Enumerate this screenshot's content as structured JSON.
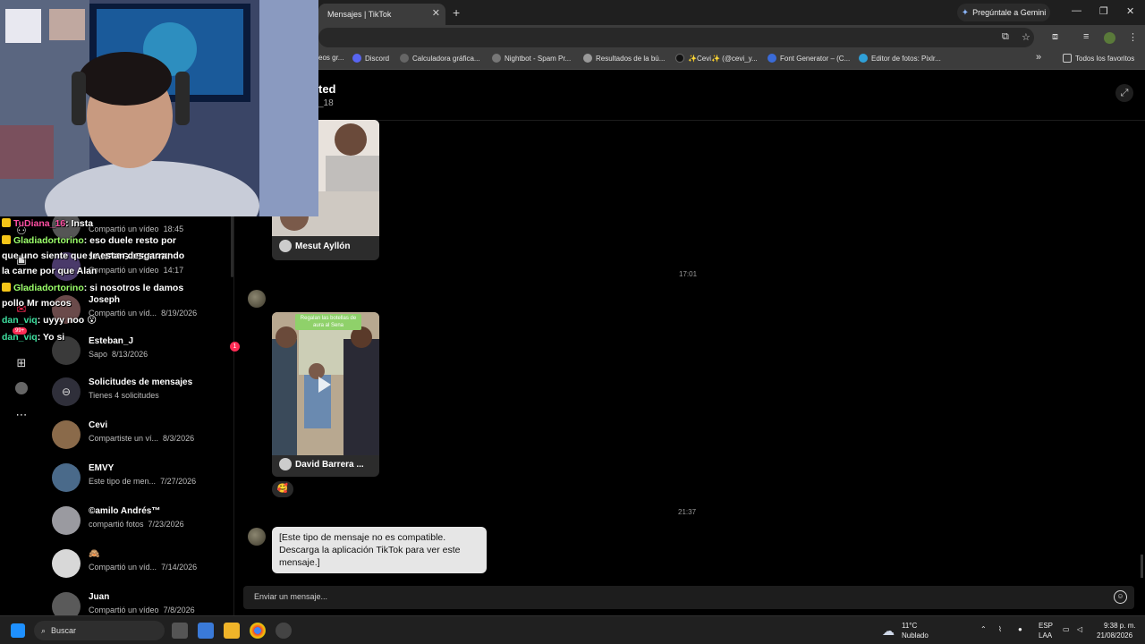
{
  "browser": {
    "active_tab_title": "Mensajes | TikTok",
    "tab_close": "✕",
    "new_tab": "+",
    "gemini_label": "Pregúntale a Gemini",
    "window_controls": [
      "—",
      "❐",
      "✕"
    ],
    "bookmarks": [
      {
        "label": "eos gr..."
      },
      {
        "label": "Discord"
      },
      {
        "label": "Calculadora gráfica..."
      },
      {
        "label": "Nightbot - Spam Pr..."
      },
      {
        "label": "Resultados de la bú..."
      },
      {
        "label": "✨Cevi✨ (@cevi_y..."
      },
      {
        "label": "Font Generator – (C..."
      },
      {
        "label": "Editor de fotos: Pixlr..."
      }
    ],
    "bookmarks_overflow": "»",
    "all_bookmarks": "Todos los favoritos"
  },
  "chat_header": {
    "name": "ted",
    "username": "_18"
  },
  "conversations": [
    {
      "name": "",
      "sub": "Compartió un vídeo",
      "time": "18:45"
    },
    {
      "name": "SANTIAGOELMANI",
      "sub": "Compartió un vídeo",
      "time": "14:17"
    },
    {
      "name": "Joseph",
      "sub": "Compartió un víd...",
      "time": "8/19/2026"
    },
    {
      "name": "Esteban_J",
      "sub": "Sapo",
      "time": "8/13/2026",
      "unread": "1"
    },
    {
      "name": "Solicitudes de mensajes",
      "sub": "Tienes 4 solicitudes",
      "time": ""
    },
    {
      "name": "Cevi",
      "sub": "Compartiste un ví...",
      "time": "8/3/2026"
    },
    {
      "name": "EMVY",
      "sub": "Este tipo de men...",
      "time": "7/27/2026"
    },
    {
      "name": "©amilo Andrés™",
      "sub": "compartió fotos",
      "time": "7/23/2026"
    },
    {
      "name": "🙈",
      "sub": "Compartió un víd...",
      "time": "7/14/2026"
    },
    {
      "name": "Juan",
      "sub": "Compartió un vídeo",
      "time": "7/8/2026"
    }
  ],
  "rail": {
    "badge": "99+"
  },
  "messages": {
    "video1_author": "Mesut Ayllón",
    "time1": "17:01",
    "video2_banner": "Regalan las botellas de aura al Sena",
    "video2_author": "David Barrera ...",
    "reaction": "🥰",
    "time2": "21:37",
    "unsupported": "[Este tipo de mensaje no es compatible. Descarga la aplicación TikTok para ver este mensaje.]"
  },
  "composer": {
    "placeholder": "Enviar un mensaje..."
  },
  "stream_chat": [
    {
      "user": "TuDiana_16",
      "text": ": Insta",
      "color": "#ff4fa3"
    },
    {
      "user": "Gladiadortorino",
      "text": ": eso duele resto por",
      "color": "#9bff6a"
    },
    {
      "user": "",
      "text": "que uno siente que le estan desgarrando",
      "color": "#ffffff"
    },
    {
      "user": "",
      "text": "la carne por que Alan",
      "color": "#ffffff"
    },
    {
      "user": "Gladiadortorino",
      "text": ": si nosotros le damos",
      "color": "#9bff6a"
    },
    {
      "user": "",
      "text": "pollo Mr mocos",
      "color": "#ffffff"
    },
    {
      "user": "dan_viq",
      "text": ": uyyy noo 😮",
      "color": "#3fe0a0"
    },
    {
      "user": "dan_viq",
      "text": ": Yo si",
      "color": "#3fe0a0"
    }
  ],
  "taskbar": {
    "search": "Buscar",
    "weather_temp": "11°C",
    "weather_desc": "Nublado",
    "lang1": "ESP",
    "lang2": "LAA",
    "time": "9:38 p. m.",
    "date": "21/08/2026"
  }
}
